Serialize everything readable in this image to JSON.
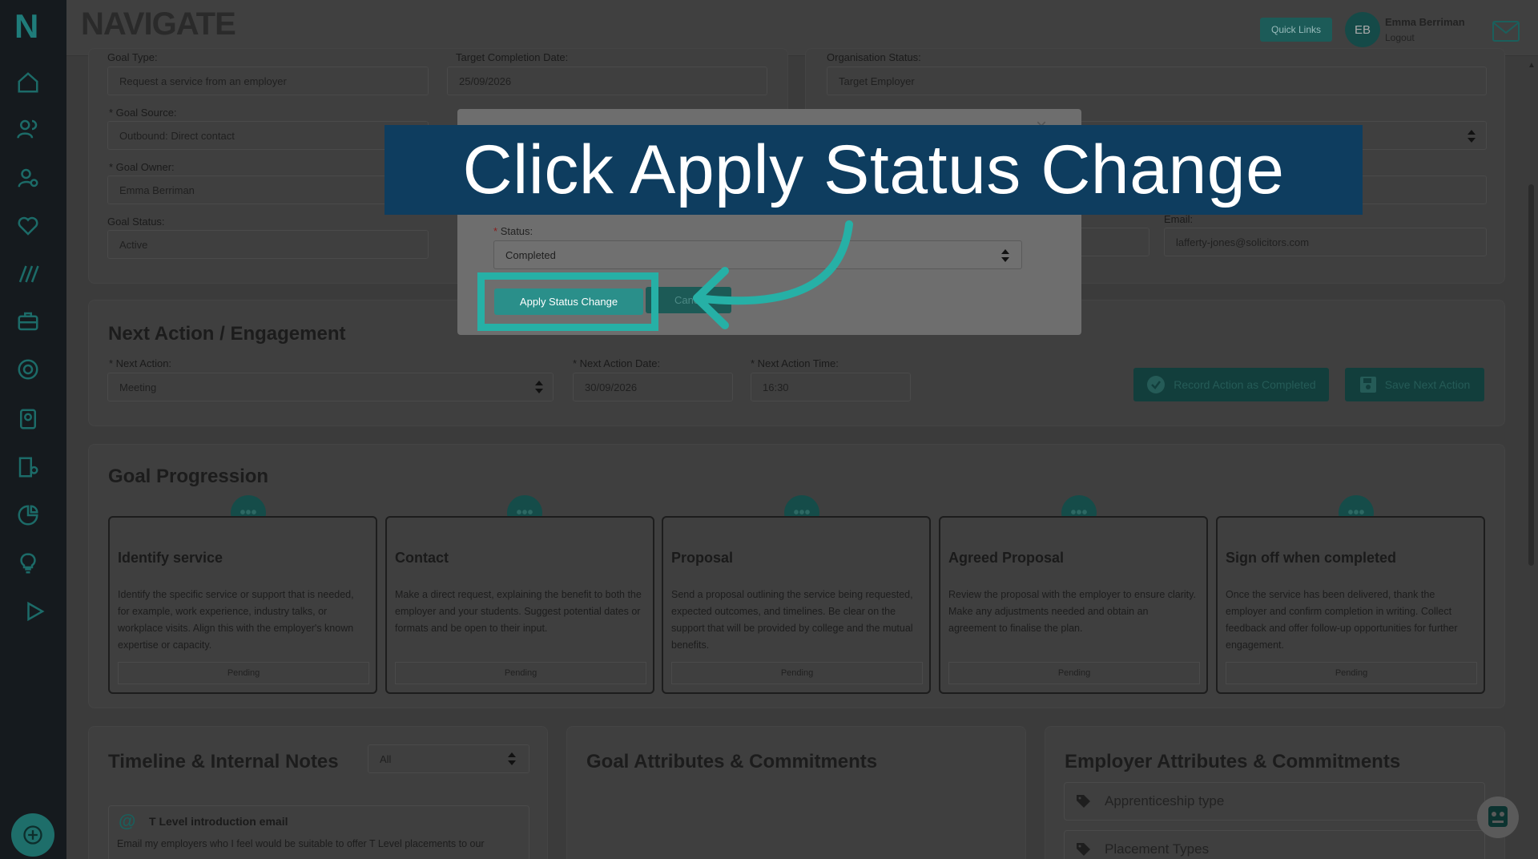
{
  "brand": {
    "name": "NAVIGATE",
    "side_letter": "N"
  },
  "topbar": {
    "quick_links": "Quick Links",
    "avatar_initials": "EB",
    "user_name": "Emma Berriman",
    "logout": "Logout"
  },
  "goal_details": {
    "goal_type_label": "Goal Type:",
    "goal_type_value": "Request a service from an employer",
    "target_date_label": "Target Completion Date:",
    "target_date_value": "25/09/2026",
    "goal_source_label": "* Goal Source:",
    "goal_source_value": "Outbound: Direct contact",
    "goal_owner_label": "* Goal Owner:",
    "goal_owner_value": "Emma Berriman",
    "goal_status_label": "Goal Status:",
    "goal_status_value": "Active"
  },
  "org_details": {
    "org_status_label": "Organisation Status:",
    "org_status_value": "Target Employer",
    "email_label": "Email:",
    "email_value": "lafferty-jones@solicitors.com"
  },
  "next_action": {
    "title": "Next Action / Engagement",
    "action_label": "* Next Action:",
    "action_value": "Meeting",
    "date_label": "* Next Action Date:",
    "date_value": "30/09/2026",
    "time_label": "* Next Action Time:",
    "time_value": "16:30",
    "record_button": "Record Action as Completed",
    "save_button": "Save Next Action"
  },
  "goal_progression": {
    "title": "Goal Progression",
    "steps": [
      {
        "title": "Identify service",
        "desc": "Identify the specific service or support that is needed, for example, work experience, industry talks, or workplace visits. Align this with the employer's known expertise or capacity.",
        "status": "Pending"
      },
      {
        "title": "Contact",
        "desc": "Make a direct request, explaining the benefit to both the employer and your students. Suggest potential dates or formats and be open to their input.",
        "status": "Pending"
      },
      {
        "title": "Proposal",
        "desc": "Send a proposal outlining the service being requested, expected outcomes, and timelines. Be clear on the support that will be provided by college and the mutual benefits.",
        "status": "Pending"
      },
      {
        "title": "Agreed Proposal",
        "desc": "Review the proposal with the employer to ensure clarity. Make any adjustments needed and obtain an agreement to finalise the plan.",
        "status": "Pending"
      },
      {
        "title": "Sign off when completed",
        "desc": "Once the service has been delivered, thank the employer and confirm completion in writing. Collect feedback and offer follow-up opportunities for further engagement.",
        "status": "Pending"
      }
    ]
  },
  "timeline": {
    "title": "Timeline & Internal Notes",
    "filter_value": "All",
    "note_title": "T Level introduction email",
    "note_text": "Email my employers who I feel would be suitable to offer T Level placements to our"
  },
  "goal_attributes": {
    "title": "Goal Attributes & Commitments"
  },
  "employer_attributes": {
    "title": "Employer Attributes & Commitments",
    "items": [
      "Apprenticeship type",
      "Placement Types"
    ]
  },
  "modal": {
    "status_required": "*",
    "status_label": "Status:",
    "status_value": "Completed",
    "apply_button": "Apply Status Change",
    "cancel_button": "Cancel",
    "close_symbol": "×"
  },
  "callout": {
    "text": "Click Apply Status Change"
  },
  "colors": {
    "accent": "#26b0a6",
    "callout_bg": "#0e3d5f",
    "overlay": "#3f3f3f"
  }
}
